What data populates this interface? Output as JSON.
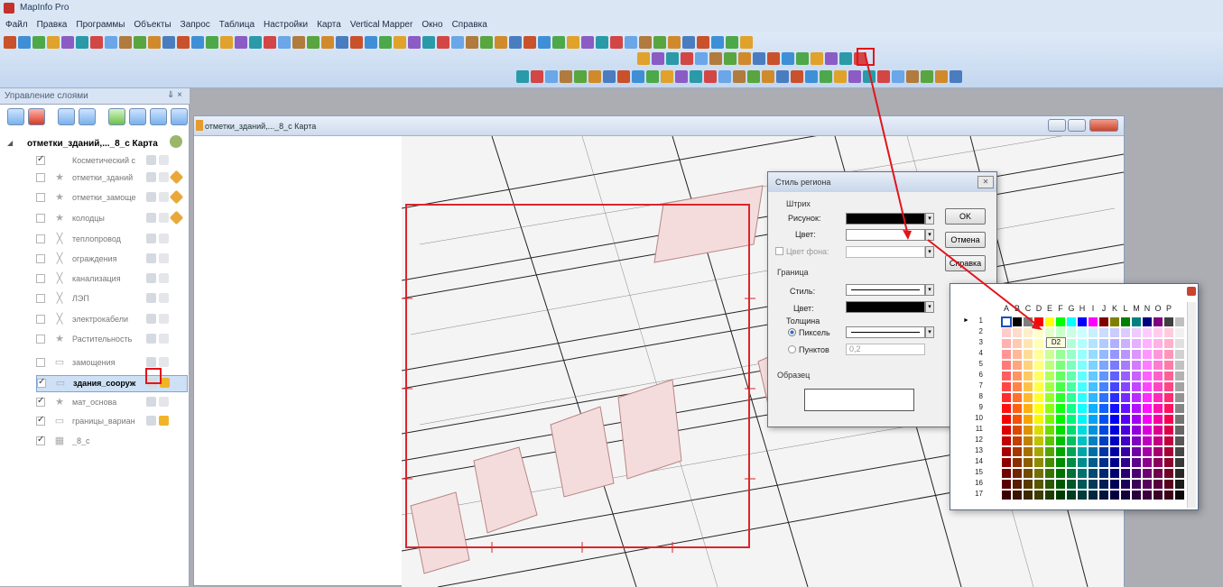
{
  "app": {
    "title": "MapInfo Pro"
  },
  "menu": [
    "Файл",
    "Правка",
    "Программы",
    "Объекты",
    "Запрос",
    "Таблица",
    "Настройки",
    "Карта",
    "Vertical Mapper",
    "Окно",
    "Справка"
  ],
  "layer_panel": {
    "title": "Управление слоями",
    "pin": "⇓ ×",
    "map_name": "отметки_зданий,..._8_с Карта",
    "layers": [
      {
        "name": "Косметический с",
        "checked": true
      },
      {
        "name": "отметки_зданий",
        "checked": false
      },
      {
        "name": "отметки_замоще",
        "checked": false
      },
      {
        "name": "колодцы",
        "checked": false
      },
      {
        "name": "теплопровод",
        "checked": false
      },
      {
        "name": "ограждения",
        "checked": false
      },
      {
        "name": "канализация",
        "checked": false
      },
      {
        "name": "ЛЭП",
        "checked": false
      },
      {
        "name": "электрокабели",
        "checked": false
      },
      {
        "name": "Растительность",
        "checked": false
      },
      {
        "name": "замощения",
        "checked": false
      },
      {
        "name": "здания_сооруж",
        "checked": true
      },
      {
        "name": "мат_основа",
        "checked": true
      },
      {
        "name": "границы_вариан",
        "checked": true
      },
      {
        "name": "_8_с",
        "checked": true
      }
    ]
  },
  "map_window": {
    "title": "отметки_зданий,..._8_с Карта"
  },
  "dialog": {
    "title": "Стиль региона",
    "fill_group": "Штрих",
    "pattern_label": "Рисунок:",
    "color_label": "Цвет:",
    "bg_label": "Цвет фона:",
    "border_group": "Граница",
    "style_label": "Стиль:",
    "border_color_label": "Цвет:",
    "thickness_label": "Толщина",
    "pixels_label": "Пиксель",
    "points_label": "Пунктов",
    "points_value": "0,2",
    "sample_label": "Образец",
    "ok": "OK",
    "cancel": "Отмена",
    "help": "Справка"
  },
  "palette": {
    "columns": [
      "A",
      "B",
      "C",
      "D",
      "E",
      "F",
      "G",
      "H",
      "I",
      "J",
      "K",
      "L",
      "M",
      "N",
      "O",
      "P"
    ],
    "rows": [
      "1",
      "2",
      "3",
      "4",
      "5",
      "6",
      "7",
      "8",
      "9",
      "10",
      "11",
      "12",
      "13",
      "14",
      "15",
      "16",
      "17"
    ],
    "tooltip": "D2"
  }
}
